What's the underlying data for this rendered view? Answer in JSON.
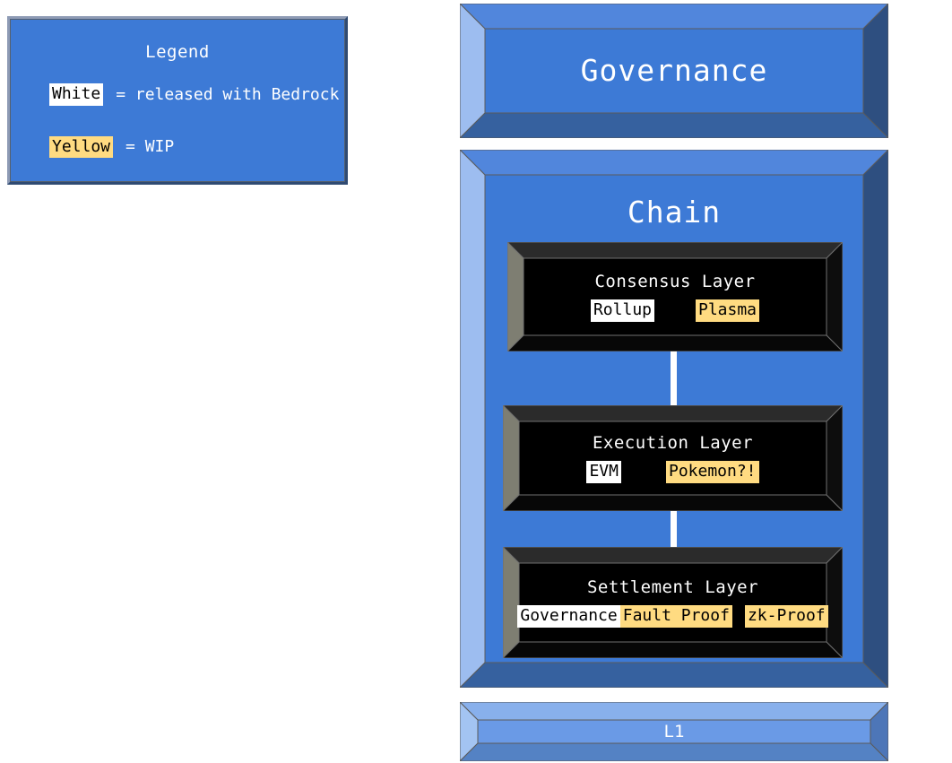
{
  "legend": {
    "title": "Legend",
    "rows": [
      {
        "chip": "White",
        "style": "white",
        "desc": "= released with Bedrock"
      },
      {
        "chip": "Yellow",
        "style": "yellow",
        "desc": "= WIP"
      }
    ]
  },
  "diagram": {
    "governance": {
      "title": "Governance"
    },
    "chain": {
      "title": "Chain",
      "layers": [
        {
          "title": "Consensus Layer",
          "tags": [
            {
              "label": "Rollup",
              "style": "white"
            },
            {
              "label": "Plasma",
              "style": "yellow"
            }
          ]
        },
        {
          "title": "Execution Layer",
          "tags": [
            {
              "label": "EVM",
              "style": "white"
            },
            {
              "label": "Pokemon?!",
              "style": "yellow"
            }
          ]
        },
        {
          "title": "Settlement Layer",
          "tags": [
            {
              "label": "Governance",
              "style": "white"
            },
            {
              "label": "Fault Proof",
              "style": "yellow"
            },
            {
              "label": "zk-Proof",
              "style": "yellow"
            }
          ]
        }
      ]
    },
    "l1": {
      "title": "L1"
    }
  },
  "colors": {
    "panel_blue": "#3d7ad6",
    "bevel_light": "#7da6e8",
    "bevel_top": "#5186dc",
    "bevel_right": "#2e4f80",
    "bevel_bottom": "#36619f",
    "l1_fill": "#6a9ae6",
    "l1_light": "#a3c4f2",
    "l1_top": "#88b0ec",
    "l1_right": "#4d76b8",
    "l1_bottom": "#5482c4",
    "box_black": "#000000",
    "box_bevel_gray": "#7e7e72",
    "box_bevel_dark": "#2b2b2b",
    "tag_white": "#ffffff",
    "tag_yellow": "#ffdb81",
    "connector": "#ffffff"
  }
}
